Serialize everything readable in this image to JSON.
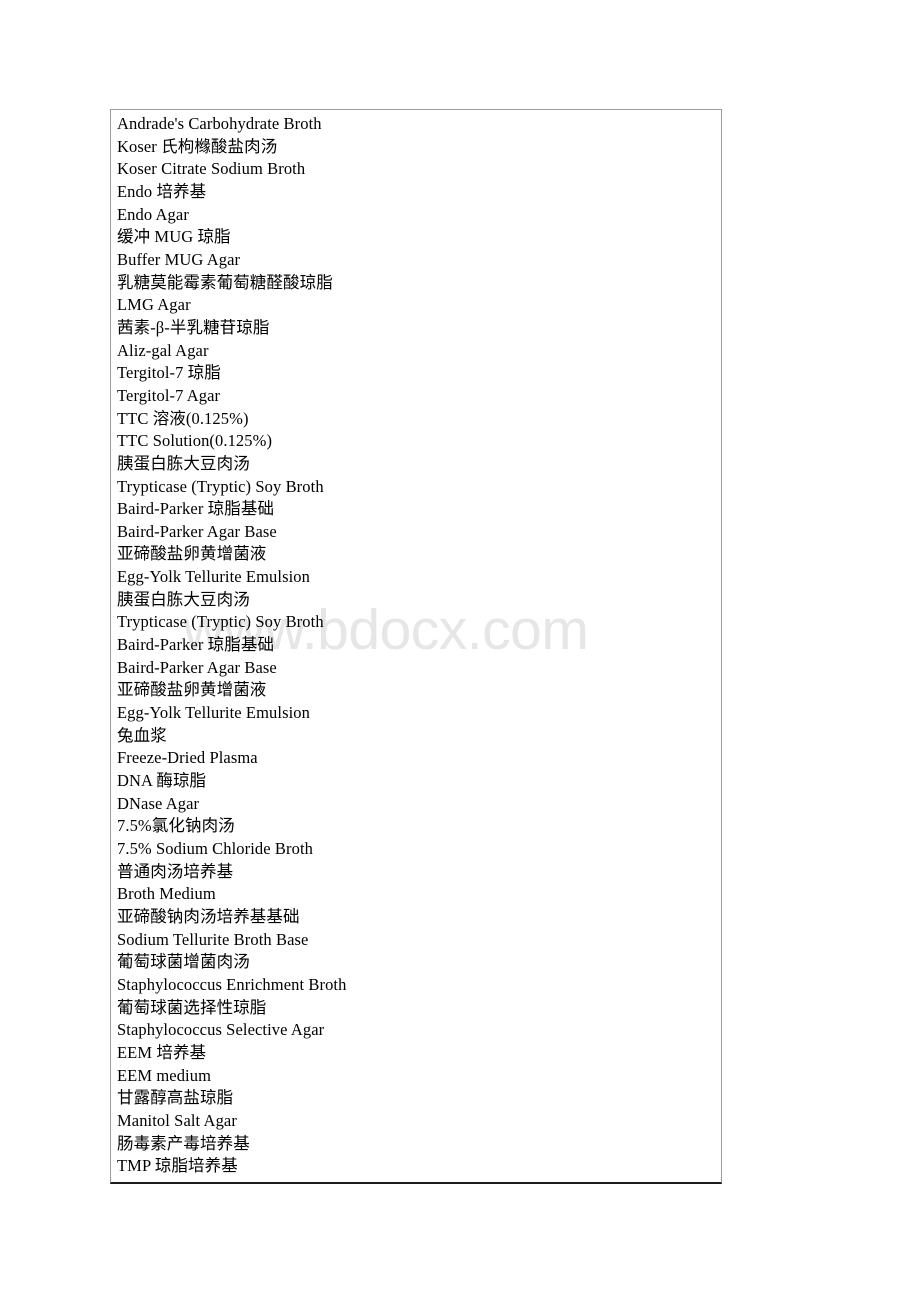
{
  "document": {
    "watermark": "www.bdocx.com",
    "table": {
      "rows": [
        {
          "text": "Andrade's Carbohydrate Broth",
          "lang": "en"
        },
        {
          "text": "Koser 氏枸橼酸盐肉汤",
          "lang": "zh"
        },
        {
          "text": "Koser Citrate Sodium Broth",
          "lang": "en"
        },
        {
          "text": "Endo 培养基",
          "lang": "zh"
        },
        {
          "text": "Endo Agar",
          "lang": "en"
        },
        {
          "text": "缓冲 MUG 琼脂",
          "lang": "zh"
        },
        {
          "text": "Buffer MUG Agar",
          "lang": "en"
        },
        {
          "text": "乳糖莫能霉素葡萄糖醛酸琼脂",
          "lang": "zh"
        },
        {
          "text": "LMG Agar",
          "lang": "en"
        },
        {
          "text": "茜素-β-半乳糖苷琼脂",
          "lang": "zh"
        },
        {
          "text": "Aliz-gal Agar",
          "lang": "en"
        },
        {
          "text": "Tergitol-7 琼脂",
          "lang": "zh"
        },
        {
          "text": "Tergitol-7 Agar",
          "lang": "en"
        },
        {
          "text": "TTC 溶液(0.125%)",
          "lang": "zh"
        },
        {
          "text": "TTC Solution(0.125%)",
          "lang": "en"
        },
        {
          "text": "胰蛋白胨大豆肉汤",
          "lang": "zh"
        },
        {
          "text": "Trypticase (Tryptic) Soy Broth",
          "lang": "en"
        },
        {
          "text": "Baird-Parker 琼脂基础",
          "lang": "zh"
        },
        {
          "text": "Baird-Parker Agar Base",
          "lang": "en"
        },
        {
          "text": "亚碲酸盐卵黄增菌液",
          "lang": "zh"
        },
        {
          "text": "Egg-Yolk Tellurite Emulsion",
          "lang": "en"
        },
        {
          "text": "胰蛋白胨大豆肉汤",
          "lang": "zh"
        },
        {
          "text": "Trypticase (Tryptic) Soy Broth",
          "lang": "en"
        },
        {
          "text": "Baird-Parker 琼脂基础",
          "lang": "zh"
        },
        {
          "text": "Baird-Parker Agar Base",
          "lang": "en"
        },
        {
          "text": "亚碲酸盐卵黄增菌液",
          "lang": "zh"
        },
        {
          "text": "Egg-Yolk Tellurite Emulsion",
          "lang": "en"
        },
        {
          "text": "兔血浆",
          "lang": "zh"
        },
        {
          "text": "Freeze-Dried Plasma",
          "lang": "en"
        },
        {
          "text": "DNA 酶琼脂",
          "lang": "zh"
        },
        {
          "text": "DNase Agar",
          "lang": "en"
        },
        {
          "text": "7.5%氯化钠肉汤",
          "lang": "zh"
        },
        {
          "text": "7.5% Sodium Chloride Broth",
          "lang": "en"
        },
        {
          "text": "普通肉汤培养基",
          "lang": "zh"
        },
        {
          "text": "Broth Medium",
          "lang": "en"
        },
        {
          "text": "亚碲酸钠肉汤培养基基础",
          "lang": "zh"
        },
        {
          "text": "Sodium Tellurite Broth Base",
          "lang": "en"
        },
        {
          "text": "葡萄球菌增菌肉汤",
          "lang": "zh"
        },
        {
          "text": "Staphylococcus Enrichment Broth",
          "lang": "en"
        },
        {
          "text": "葡萄球菌选择性琼脂",
          "lang": "zh"
        },
        {
          "text": "Staphylococcus Selective Agar",
          "lang": "en"
        },
        {
          "text": "EEM 培养基",
          "lang": "zh"
        },
        {
          "text": "EEM medium",
          "lang": "en"
        },
        {
          "text": "甘露醇高盐琼脂",
          "lang": "zh"
        },
        {
          "text": "Manitol Salt Agar",
          "lang": "en"
        },
        {
          "text": "肠毒素产毒培养基",
          "lang": "zh"
        },
        {
          "text": "TMP 琼脂培养基",
          "lang": "zh"
        }
      ]
    }
  }
}
